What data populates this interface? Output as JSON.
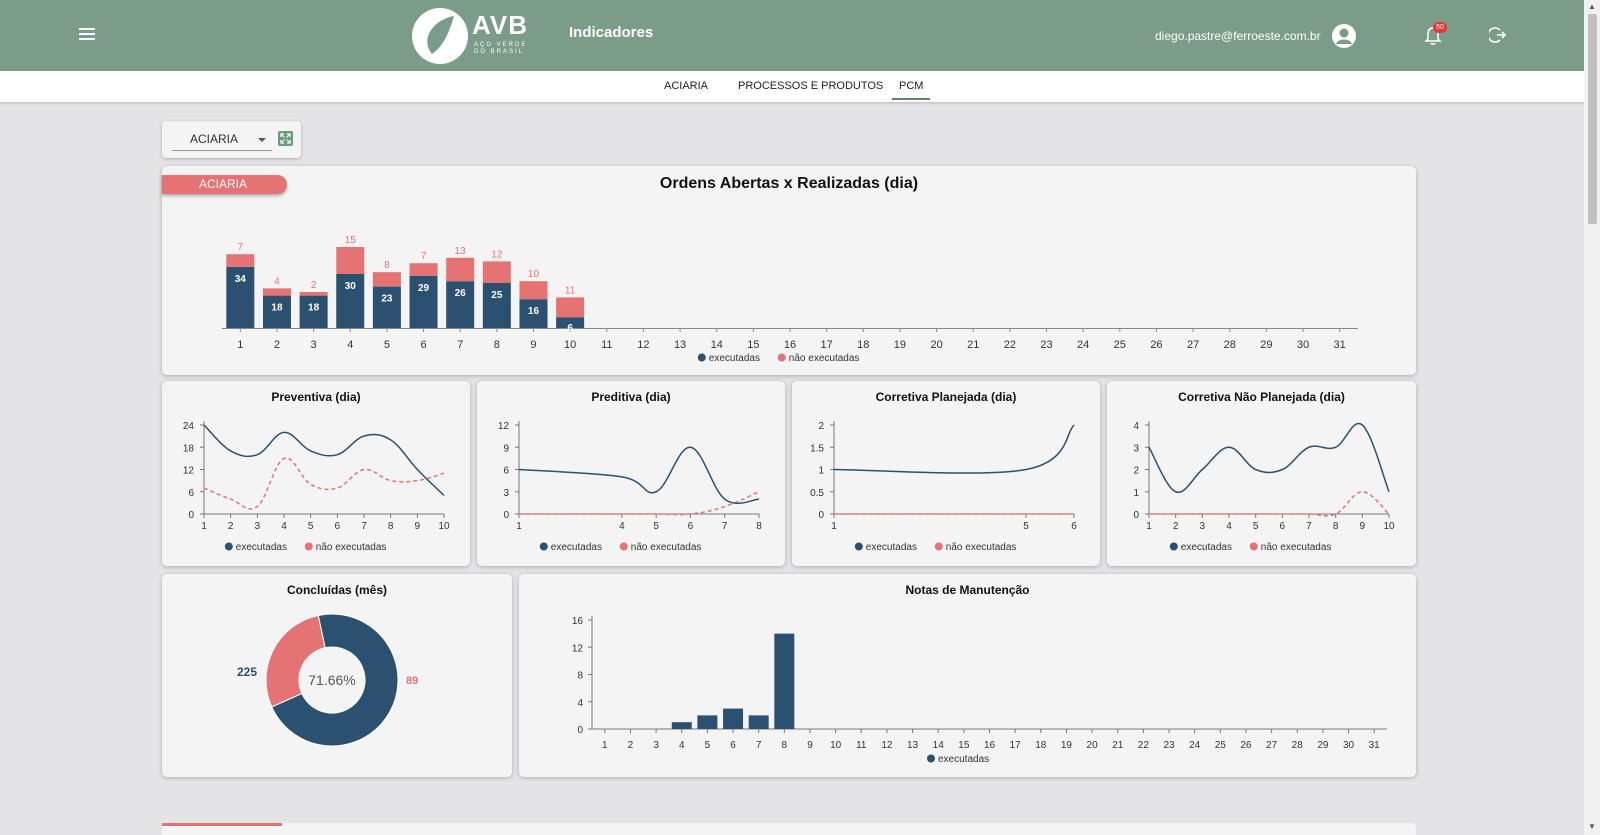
{
  "header": {
    "logo_text": "AVB",
    "logo_sub": "AÇO VERDE DO BRASIL",
    "title": "Indicadores",
    "user_email": "diego.pastre@ferroeste.com.br",
    "notifications": "50"
  },
  "nav": {
    "tabs": [
      "ACIARIA",
      "PROCESSOS E PRODUTOS",
      "PCM"
    ],
    "active": "PCM"
  },
  "filter": {
    "selected": "ACIARIA"
  },
  "colors": {
    "executadas": "#2b5070",
    "nao_executadas": "#e57373",
    "accent": "#7a9c88"
  },
  "main_card": {
    "tag": "ACIARIA"
  },
  "legend": {
    "exec": "executadas",
    "nao": "não executadas"
  },
  "chart_data": [
    {
      "id": "ordens",
      "type": "bar",
      "title": "Ordens Abertas x Realizadas (dia)",
      "categories": [
        "1",
        "2",
        "3",
        "4",
        "5",
        "6",
        "7",
        "8",
        "9",
        "10",
        "11",
        "12",
        "13",
        "14",
        "15",
        "16",
        "17",
        "18",
        "19",
        "20",
        "21",
        "22",
        "23",
        "24",
        "25",
        "26",
        "27",
        "28",
        "29",
        "30",
        "31"
      ],
      "series": [
        {
          "name": "executadas",
          "values": [
            34,
            18,
            18,
            30,
            23,
            29,
            26,
            25,
            16,
            6
          ]
        },
        {
          "name": "não executadas",
          "values": [
            7,
            4,
            2,
            15,
            8,
            7,
            13,
            12,
            10,
            11
          ]
        }
      ]
    },
    {
      "id": "preventiva",
      "type": "line",
      "title": "Preventiva (dia)",
      "x": [
        1,
        2,
        3,
        4,
        5,
        6,
        7,
        8,
        9,
        10
      ],
      "yticks": [
        0,
        6,
        12,
        18,
        24
      ],
      "ylim": [
        0,
        24
      ],
      "series": [
        {
          "name": "executadas",
          "values": [
            24,
            17,
            16,
            22,
            17,
            16,
            21,
            20,
            12,
            5
          ]
        },
        {
          "name": "não executadas",
          "values": [
            7,
            4,
            2,
            15,
            8,
            7,
            12,
            9,
            9,
            11
          ]
        }
      ]
    },
    {
      "id": "preditiva",
      "type": "line",
      "title": "Preditiva (dia)",
      "x": [
        1,
        4,
        5,
        6,
        7,
        8
      ],
      "yticks": [
        0,
        3,
        6,
        9,
        12
      ],
      "ylim": [
        0,
        12
      ],
      "series": [
        {
          "name": "executadas",
          "values": [
            6,
            5,
            3,
            9,
            2,
            2
          ]
        },
        {
          "name": "não executadas",
          "values": [
            0,
            0,
            0,
            0,
            1,
            3
          ]
        }
      ]
    },
    {
      "id": "corretiva_planejada",
      "type": "line",
      "title": "Corretiva Planejada (dia)",
      "x": [
        1,
        5,
        6
      ],
      "yticks": [
        "0",
        "0.5",
        "1",
        "1.5",
        "2"
      ],
      "ylim": [
        0,
        2
      ],
      "series": [
        {
          "name": "executadas",
          "values": [
            1,
            1,
            2
          ]
        },
        {
          "name": "não executadas",
          "values": [
            0,
            0,
            0
          ]
        }
      ]
    },
    {
      "id": "corretiva_nao_planejada",
      "type": "line",
      "title": "Corretiva Não Planejada (dia)",
      "x": [
        1,
        2,
        3,
        4,
        5,
        6,
        7,
        8,
        9,
        10
      ],
      "yticks": [
        0,
        1,
        2,
        3,
        4
      ],
      "ylim": [
        0,
        4
      ],
      "series": [
        {
          "name": "executadas",
          "values": [
            3,
            1,
            2,
            3,
            2,
            2,
            3,
            3,
            4,
            1
          ]
        },
        {
          "name": "não executadas",
          "values": [
            0,
            0,
            0,
            0,
            0,
            0,
            0,
            0,
            1,
            0
          ]
        }
      ]
    },
    {
      "id": "concluidas",
      "type": "pie",
      "title": "Concluídas (mês)",
      "slices": [
        {
          "name": "executadas",
          "value": 225
        },
        {
          "name": "não executadas",
          "value": 89
        }
      ],
      "center_label": "71.66%"
    },
    {
      "id": "notas",
      "type": "bar",
      "title": "Notas de Manutenção",
      "categories": [
        "1",
        "2",
        "3",
        "4",
        "5",
        "6",
        "7",
        "8",
        "9",
        "10",
        "11",
        "12",
        "13",
        "14",
        "15",
        "16",
        "17",
        "18",
        "19",
        "20",
        "21",
        "22",
        "23",
        "24",
        "25",
        "26",
        "27",
        "28",
        "29",
        "30",
        "31"
      ],
      "yticks": [
        0,
        4,
        8,
        12,
        16
      ],
      "ylim": [
        0,
        16
      ],
      "series": [
        {
          "name": "executadas",
          "values": [
            0,
            0,
            0,
            1,
            2,
            3,
            2,
            14
          ]
        }
      ]
    }
  ]
}
